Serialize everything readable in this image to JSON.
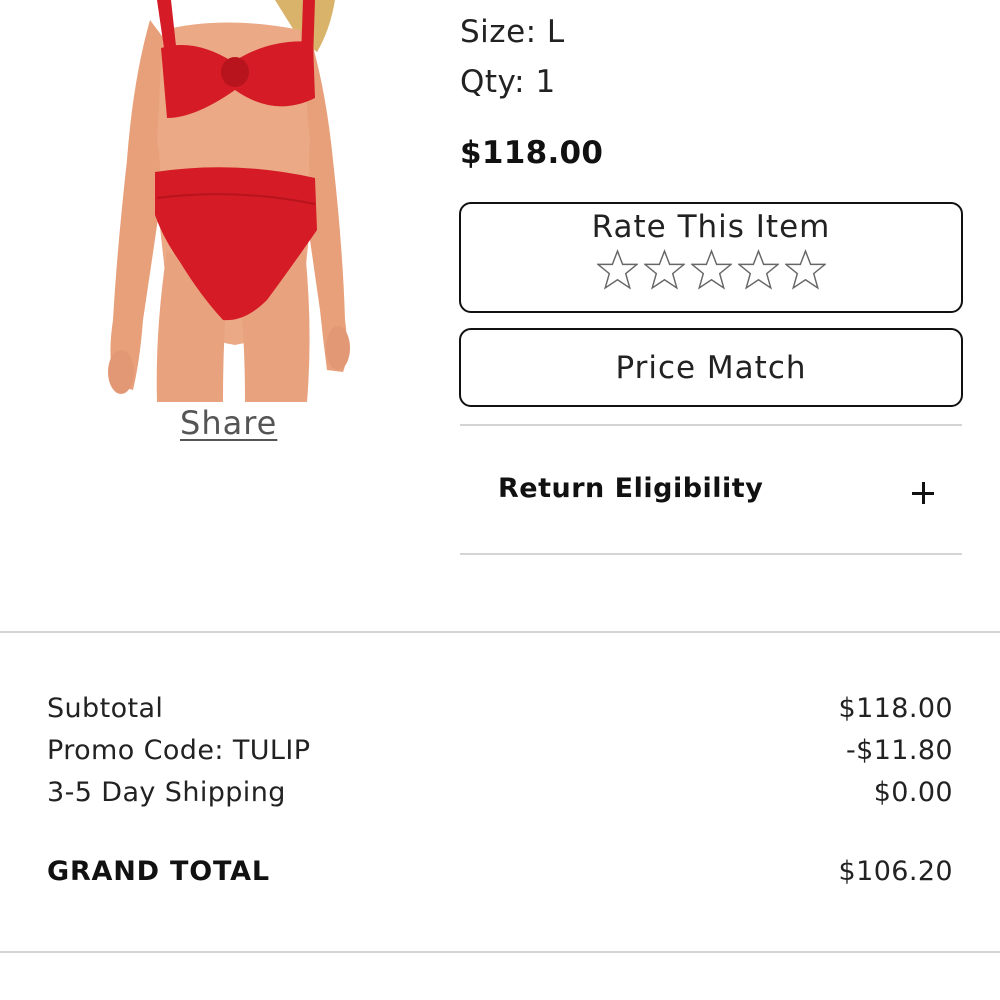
{
  "product": {
    "size": "Size: L",
    "qty": "Qty: 1",
    "price": "$118.00",
    "image_alt": "red bikini product photo",
    "swimsuit_color": "#d51b26"
  },
  "share": {
    "label": "Share"
  },
  "rate": {
    "title": "Rate This Item",
    "rating": 0,
    "max_stars": 5
  },
  "price_match": {
    "label": "Price Match"
  },
  "return_eligibility": {
    "label": "Return Eligibility",
    "expand_icon": "plus-icon"
  },
  "summary": {
    "rows": [
      {
        "label": "Subtotal",
        "value": "$118.00"
      },
      {
        "label": "Promo Code: TULIP",
        "value": "-$11.80"
      },
      {
        "label": "3-5 Day Shipping",
        "value": "$0.00"
      }
    ],
    "grand_total": {
      "label": "GRAND TOTAL",
      "value": "$106.20"
    }
  }
}
